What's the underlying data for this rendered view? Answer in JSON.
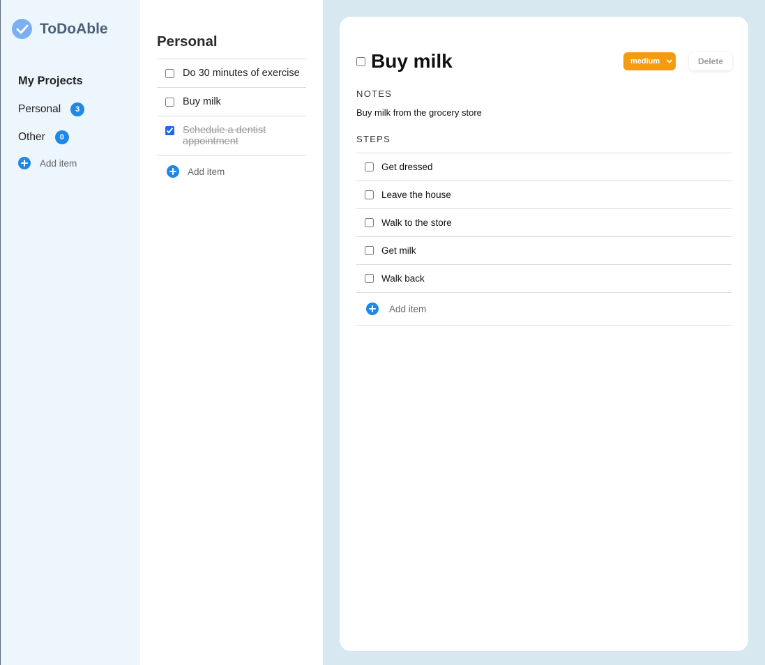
{
  "app": {
    "name": "ToDoAble"
  },
  "sidebar": {
    "heading": "My Projects",
    "projects": [
      {
        "name": "Personal",
        "count": "3"
      },
      {
        "name": "Other",
        "count": "0"
      }
    ],
    "add_label": "Add item"
  },
  "list": {
    "title": "Personal",
    "items": [
      {
        "text": "Do 30 minutes of exercise",
        "done": false
      },
      {
        "text": "Buy milk",
        "done": false
      },
      {
        "text": "Schedule a dentist appointment",
        "done": true
      }
    ],
    "add_label": "Add item"
  },
  "detail": {
    "title": "Buy milk",
    "priority": "medium",
    "delete_label": "Delete",
    "notes_label": "NOTES",
    "notes": "Buy milk from the grocery store",
    "steps_label": "STEPS",
    "steps": [
      {
        "text": "Get dressed"
      },
      {
        "text": "Leave the house"
      },
      {
        "text": "Walk to the store"
      },
      {
        "text": "Get milk"
      },
      {
        "text": "Walk back"
      }
    ],
    "add_label": "Add item"
  },
  "colors": {
    "accent": "#1e88e5",
    "priority_medium": "#f39c12",
    "sidebar_bg": "#edf6fd",
    "page_bg": "#d7e8f1"
  },
  "icons": {
    "logo": "check-circle-icon",
    "add": "plus-circle-icon",
    "priority_dropdown": "chevron-down-icon"
  }
}
